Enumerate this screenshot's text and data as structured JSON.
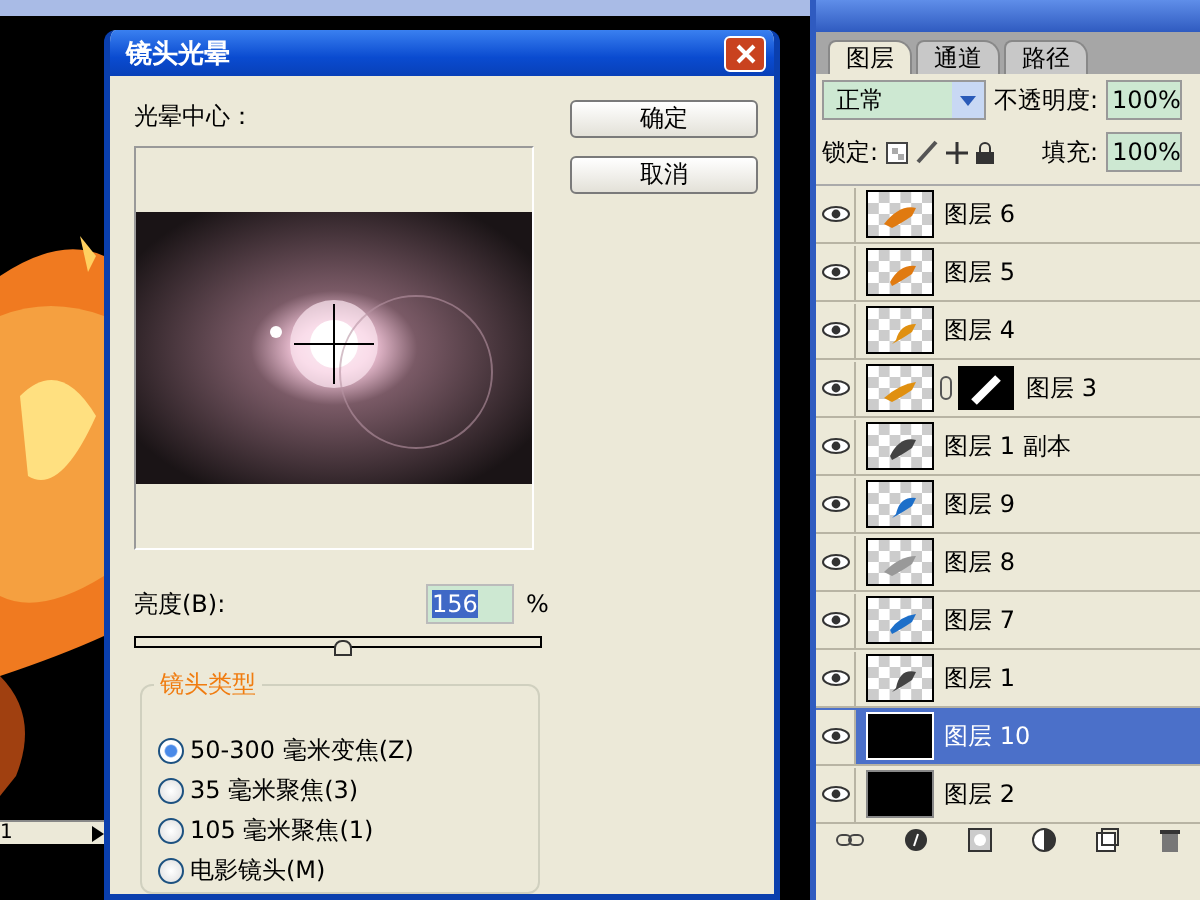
{
  "dialog": {
    "title": "镜头光晕",
    "center_label": "光晕中心：",
    "buttons": [
      "确定",
      "取消"
    ],
    "brightness": {
      "label": "亮度(B):",
      "value": "156",
      "unit": "%",
      "level": 0.51
    },
    "lens_group": {
      "title": "镜头类型",
      "options": [
        {
          "label": "50-300 毫米变焦(Z)",
          "selected": true
        },
        {
          "label": "35 毫米聚焦(3)",
          "selected": false
        },
        {
          "label": "105 毫米聚焦(1)",
          "selected": false
        },
        {
          "label": "电影镜头(M)",
          "selected": false
        }
      ]
    }
  },
  "layers_panel": {
    "tabs": [
      {
        "label": "图层",
        "selected": true
      },
      {
        "label": "通道",
        "selected": false
      },
      {
        "label": "路径",
        "selected": false
      }
    ],
    "blend_mode": "正常",
    "opacity_label": "不透明度:",
    "opacity": "100%",
    "lock_label": "锁定:",
    "fill_label": "填充:",
    "fill": "100%",
    "layers": [
      {
        "name": "图层 6",
        "visible": true,
        "selected": false,
        "kind": "transparent",
        "mask": false
      },
      {
        "name": "图层 5",
        "visible": true,
        "selected": false,
        "kind": "transparent",
        "mask": false
      },
      {
        "name": "图层 4",
        "visible": true,
        "selected": false,
        "kind": "transparent",
        "mask": false
      },
      {
        "name": "图层 3",
        "visible": true,
        "selected": false,
        "kind": "transparent",
        "mask": true
      },
      {
        "name": "图层 1 副本",
        "visible": true,
        "selected": false,
        "kind": "transparent",
        "mask": false
      },
      {
        "name": "图层 9",
        "visible": true,
        "selected": false,
        "kind": "transparent",
        "mask": false
      },
      {
        "name": "图层 8",
        "visible": true,
        "selected": false,
        "kind": "transparent",
        "mask": false
      },
      {
        "name": "图层 7",
        "visible": true,
        "selected": false,
        "kind": "transparent",
        "mask": false
      },
      {
        "name": "图层 1",
        "visible": true,
        "selected": false,
        "kind": "transparent",
        "mask": false
      },
      {
        "name": "图层 10",
        "visible": true,
        "selected": true,
        "kind": "black",
        "mask": false
      },
      {
        "name": "图层 2",
        "visible": true,
        "selected": false,
        "kind": "black",
        "mask": false
      }
    ]
  },
  "canvas_status": {
    "page": "1"
  }
}
